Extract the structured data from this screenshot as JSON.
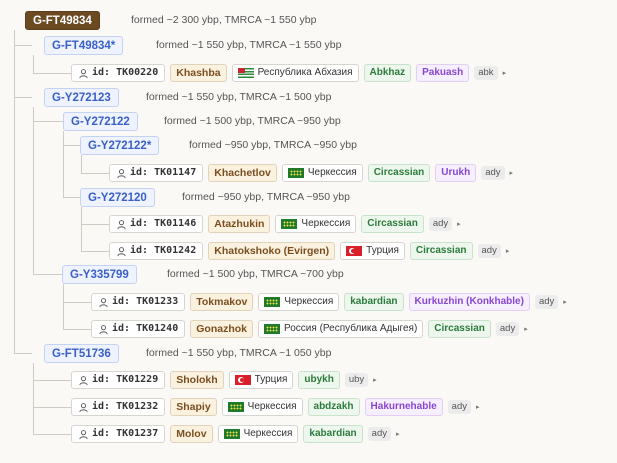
{
  "nodes": {
    "ft49834": {
      "label": "G-FT49834",
      "meta": "formed ~2 300 ybp, TMRCA ~1 550 ybp"
    },
    "ft49834s": {
      "label": "G-FT49834*",
      "meta": "formed ~1 550 ybp, TMRCA ~1 550 ybp"
    },
    "y272123": {
      "label": "G-Y272123",
      "meta": "formed ~1 550 ybp, TMRCA ~1 500 ybp"
    },
    "y272122": {
      "label": "G-Y272122",
      "meta": "formed ~1 500 ybp, TMRCA ~950 ybp"
    },
    "y272122s": {
      "label": "G-Y272122*",
      "meta": "formed ~950 ybp, TMRCA ~950 ybp"
    },
    "y272120": {
      "label": "G-Y272120",
      "meta": "formed ~950 ybp, TMRCA ~950 ybp"
    },
    "y335799": {
      "label": "G-Y335799",
      "meta": "formed ~1 500 ybp, TMRCA ~700 ybp"
    },
    "ft51736": {
      "label": "G-FT51736",
      "meta": "formed ~1 550 ybp, TMRCA ~1 050 ybp"
    }
  },
  "samples": [
    {
      "id": "id: TK00220",
      "name": "Khashba",
      "flag": "abkh",
      "place": "Республика Абхазия",
      "pop": "Abkhaz",
      "sub": "Pakuash",
      "lang": "abk"
    },
    {
      "id": "id: TK01147",
      "name": "Khachetlov",
      "flag": "circ",
      "place": "Черкессия",
      "pop": "Circassian",
      "sub": "Urukh",
      "lang": "ady"
    },
    {
      "id": "id: TK01146",
      "name": "Atazhukin",
      "flag": "circ",
      "place": "Черкессия",
      "pop": "Circassian",
      "sub": "",
      "lang": "ady"
    },
    {
      "id": "id: TK01242",
      "name": "Khatokshoko (Evirgen)",
      "flag": "tr",
      "place": "Турция",
      "pop": "Circassian",
      "sub": "",
      "lang": "ady"
    },
    {
      "id": "id: TK01233",
      "name": "Tokmakov",
      "flag": "circ",
      "place": "Черкессия",
      "pop": "kabardian",
      "sub": "Kurkuzhin (Konkhable)",
      "lang": "ady"
    },
    {
      "id": "id: TK01240",
      "name": "Gonazhok",
      "flag": "circ",
      "place": "Россия (Республика Адыгея)",
      "pop": "Circassian",
      "sub": "",
      "lang": "ady"
    },
    {
      "id": "id: TK01229",
      "name": "Sholokh",
      "flag": "tr",
      "place": "Турция",
      "pop": "ubykh",
      "sub": "",
      "lang": "uby"
    },
    {
      "id": "id: TK01232",
      "name": "Shapiy",
      "flag": "circ",
      "place": "Черкессия",
      "pop": "abdzakh",
      "sub": "Hakurnehable",
      "lang": "ady"
    },
    {
      "id": "id: TK01237",
      "name": "Molov",
      "flag": "circ",
      "place": "Черкессия",
      "pop": "kabardian",
      "sub": "",
      "lang": "ady"
    }
  ]
}
